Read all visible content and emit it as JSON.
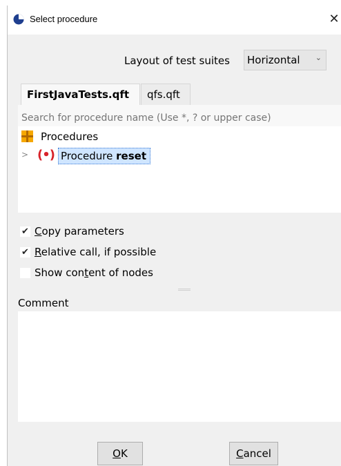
{
  "window": {
    "title": "Select procedure",
    "close_glyph": "✕"
  },
  "layout": {
    "label": "Layout of test suites",
    "selected": "Horizontal",
    "chevron": "⌄"
  },
  "tabs": [
    {
      "label": "FirstJavaTests.qft",
      "active": true
    },
    {
      "label": "qfs.qft",
      "active": false
    }
  ],
  "search": {
    "placeholder": "Search for procedure name (Use *, ? or upper case)",
    "value": ""
  },
  "tree": {
    "root_label": "Procedures",
    "expander": ">",
    "proc_icon": "(•)",
    "item_prefix": "Procedure ",
    "item_name": "reset"
  },
  "options": {
    "copy_parameters": {
      "pre": "",
      "u": "C",
      "post": "opy parameters",
      "checked": true
    },
    "relative_call": {
      "pre": "",
      "u": "R",
      "post": "elative call, if possible",
      "checked": true
    },
    "show_content": {
      "pre": "Show con",
      "u": "t",
      "post": "ent of nodes",
      "checked": false
    },
    "check_glyph": "✔"
  },
  "comment": {
    "label": "Comment",
    "value": ""
  },
  "buttons": {
    "ok_u": "O",
    "ok_rest": "K",
    "cancel_u": "C",
    "cancel_rest": "ancel"
  },
  "colors": {
    "procedure_icon": "#d8232a",
    "folder_icon": "#f6a800",
    "selection": "#cfe5ff"
  }
}
